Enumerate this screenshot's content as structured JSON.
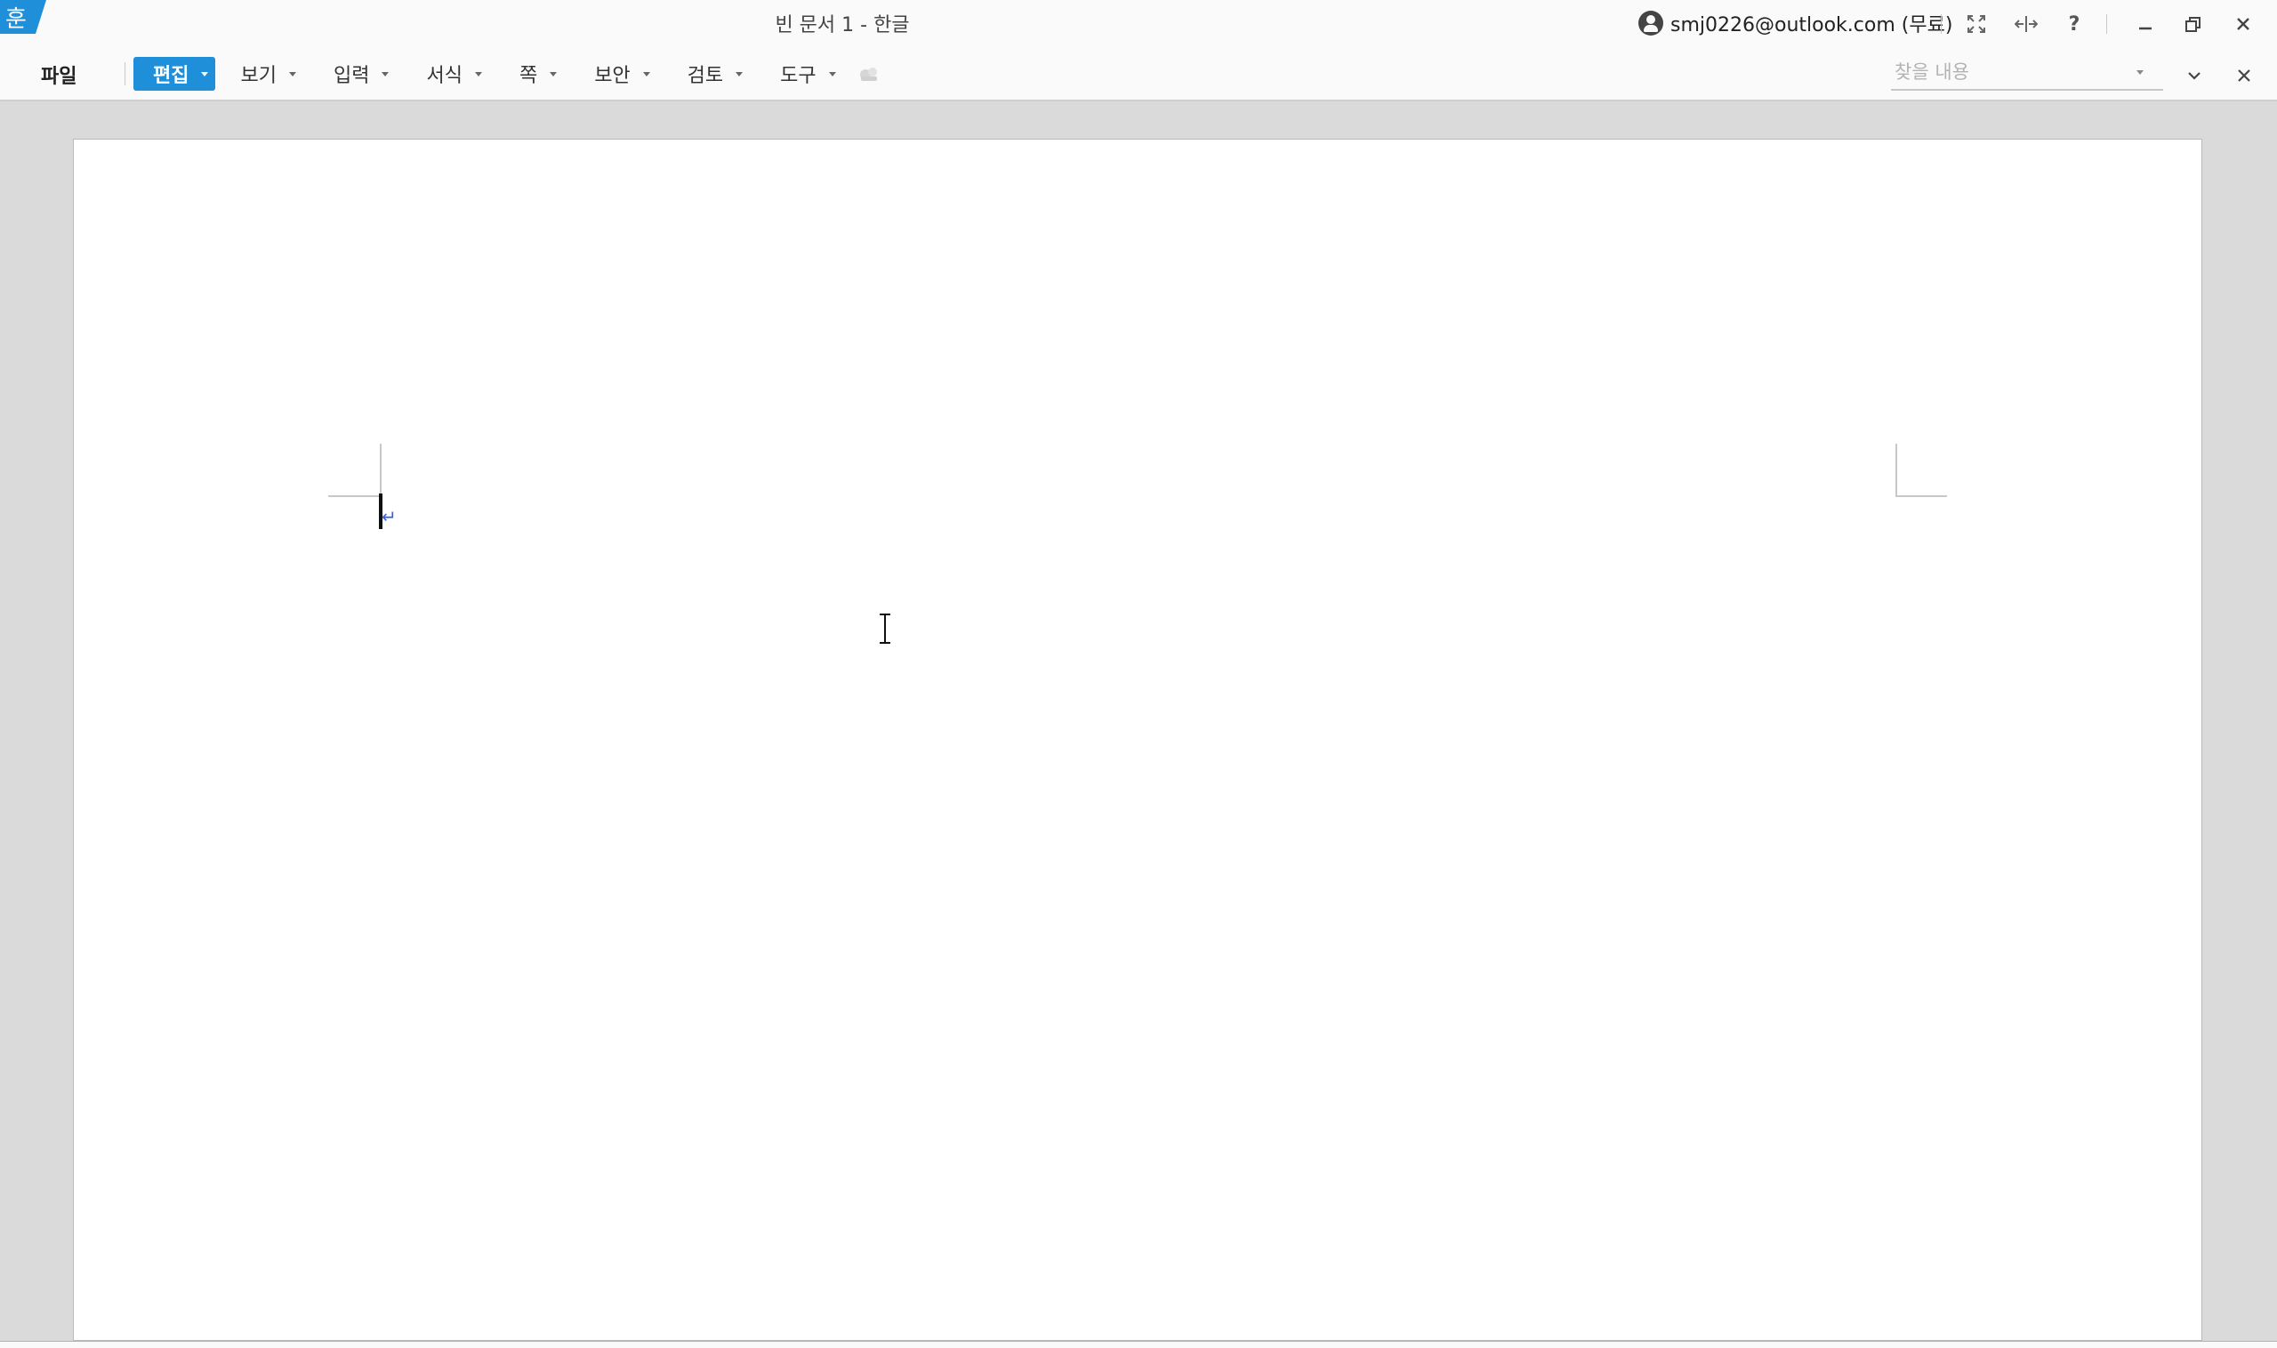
{
  "window": {
    "title": "빈 문서 1 - 한글",
    "app_logo_letter": "훈",
    "account_label": "smj0226@outlook.com (무료)",
    "help_label": "?"
  },
  "menubar": {
    "file_label": "파일",
    "items": [
      {
        "label": "편집",
        "active": true
      },
      {
        "label": "보기"
      },
      {
        "label": "입력"
      },
      {
        "label": "서식"
      },
      {
        "label": "쪽"
      },
      {
        "label": "보안"
      },
      {
        "label": "검토"
      },
      {
        "label": "도구"
      }
    ],
    "find_placeholder": "찾을 내용"
  },
  "document": {
    "paragraph_mark": "↵",
    "text": ""
  },
  "colors": {
    "accent": "#1e8fd8",
    "chrome_background": "#fafafa",
    "workspace_background": "#dadada",
    "page_background": "#ffffff",
    "paragraph_mark": "#3a62e0"
  },
  "icons": {
    "logo": "hancom-logo-icon",
    "account": "user-circle-icon",
    "fullscreen": "fullscreen-icon",
    "fit_width": "fit-width-icon",
    "help": "help-icon",
    "minimize": "minimize-icon",
    "restore": "restore-icon",
    "close": "close-icon",
    "menu_extra": "toolbox-icon",
    "find_dropdown": "chevron-down-icon",
    "ribbon_collapse": "chevron-down-icon",
    "ribbon_close": "close-icon"
  }
}
